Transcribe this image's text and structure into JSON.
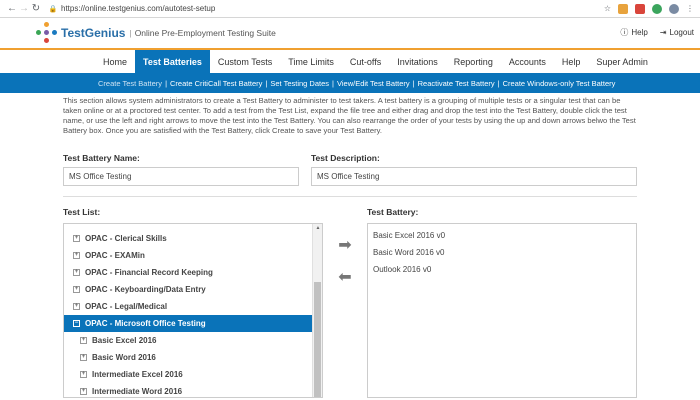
{
  "browser": {
    "url": "https://online.testgenius.com/autotest-setup"
  },
  "header": {
    "brand": "TestGenius",
    "tagline": "Online Pre-Employment Testing Suite",
    "help": "Help",
    "logout": "Logout"
  },
  "mainnav": [
    {
      "label": "Home"
    },
    {
      "label": "Test Batteries"
    },
    {
      "label": "Custom Tests"
    },
    {
      "label": "Time Limits"
    },
    {
      "label": "Cut-offs"
    },
    {
      "label": "Invitations"
    },
    {
      "label": "Reporting"
    },
    {
      "label": "Accounts"
    },
    {
      "label": "Help"
    },
    {
      "label": "Super Admin"
    }
  ],
  "subnav": [
    {
      "label": "Create Test Battery"
    },
    {
      "label": "Create CritiCall Test Battery"
    },
    {
      "label": "Set Testing Dates"
    },
    {
      "label": "View/Edit Test Battery"
    },
    {
      "label": "Reactivate Test Battery"
    },
    {
      "label": "Create Windows-only Test Battery"
    }
  ],
  "intro": "This section allows system administrators to create a Test Battery to administer to test takers. A test battery is a grouping of multiple tests or a singular test that can be taken online or at a proctored test center. To add a test from the Test List, expand the file tree and either drag and drop the test into the Test Battery, double click the test name, or use the left and right arrows to move the test into the Test Battery. You can also rearrange the order of your tests by using the up and down arrows belwo the Test Battery box. Once you are satisfied with the Test Battery, click Create to save your Test Battery.",
  "form": {
    "name_label": "Test Battery Name:",
    "name_value": "MS Office Testing",
    "desc_label": "Test Description:",
    "desc_value": "MS Office Testing"
  },
  "test_list": {
    "label": "Test List:",
    "items": [
      {
        "label": "OPAC - Clerical Skills"
      },
      {
        "label": "OPAC - EXAMin"
      },
      {
        "label": "OPAC - Financial Record Keeping"
      },
      {
        "label": "OPAC - Keyboarding/Data Entry"
      },
      {
        "label": "OPAC - Legal/Medical"
      },
      {
        "label": "OPAC - Microsoft Office Testing"
      },
      {
        "label": "Basic Excel 2016"
      },
      {
        "label": "Basic Word 2016"
      },
      {
        "label": "Intermediate Excel 2016"
      },
      {
        "label": "Intermediate Word 2016"
      }
    ]
  },
  "battery": {
    "label": "Test Battery:",
    "items": [
      {
        "label": "Basic Excel 2016 v0"
      },
      {
        "label": "Basic Word 2016 v0"
      },
      {
        "label": "Outlook 2016 v0"
      }
    ]
  },
  "colors": {
    "primary": "#0a73b9",
    "accent": "#f0a030"
  }
}
